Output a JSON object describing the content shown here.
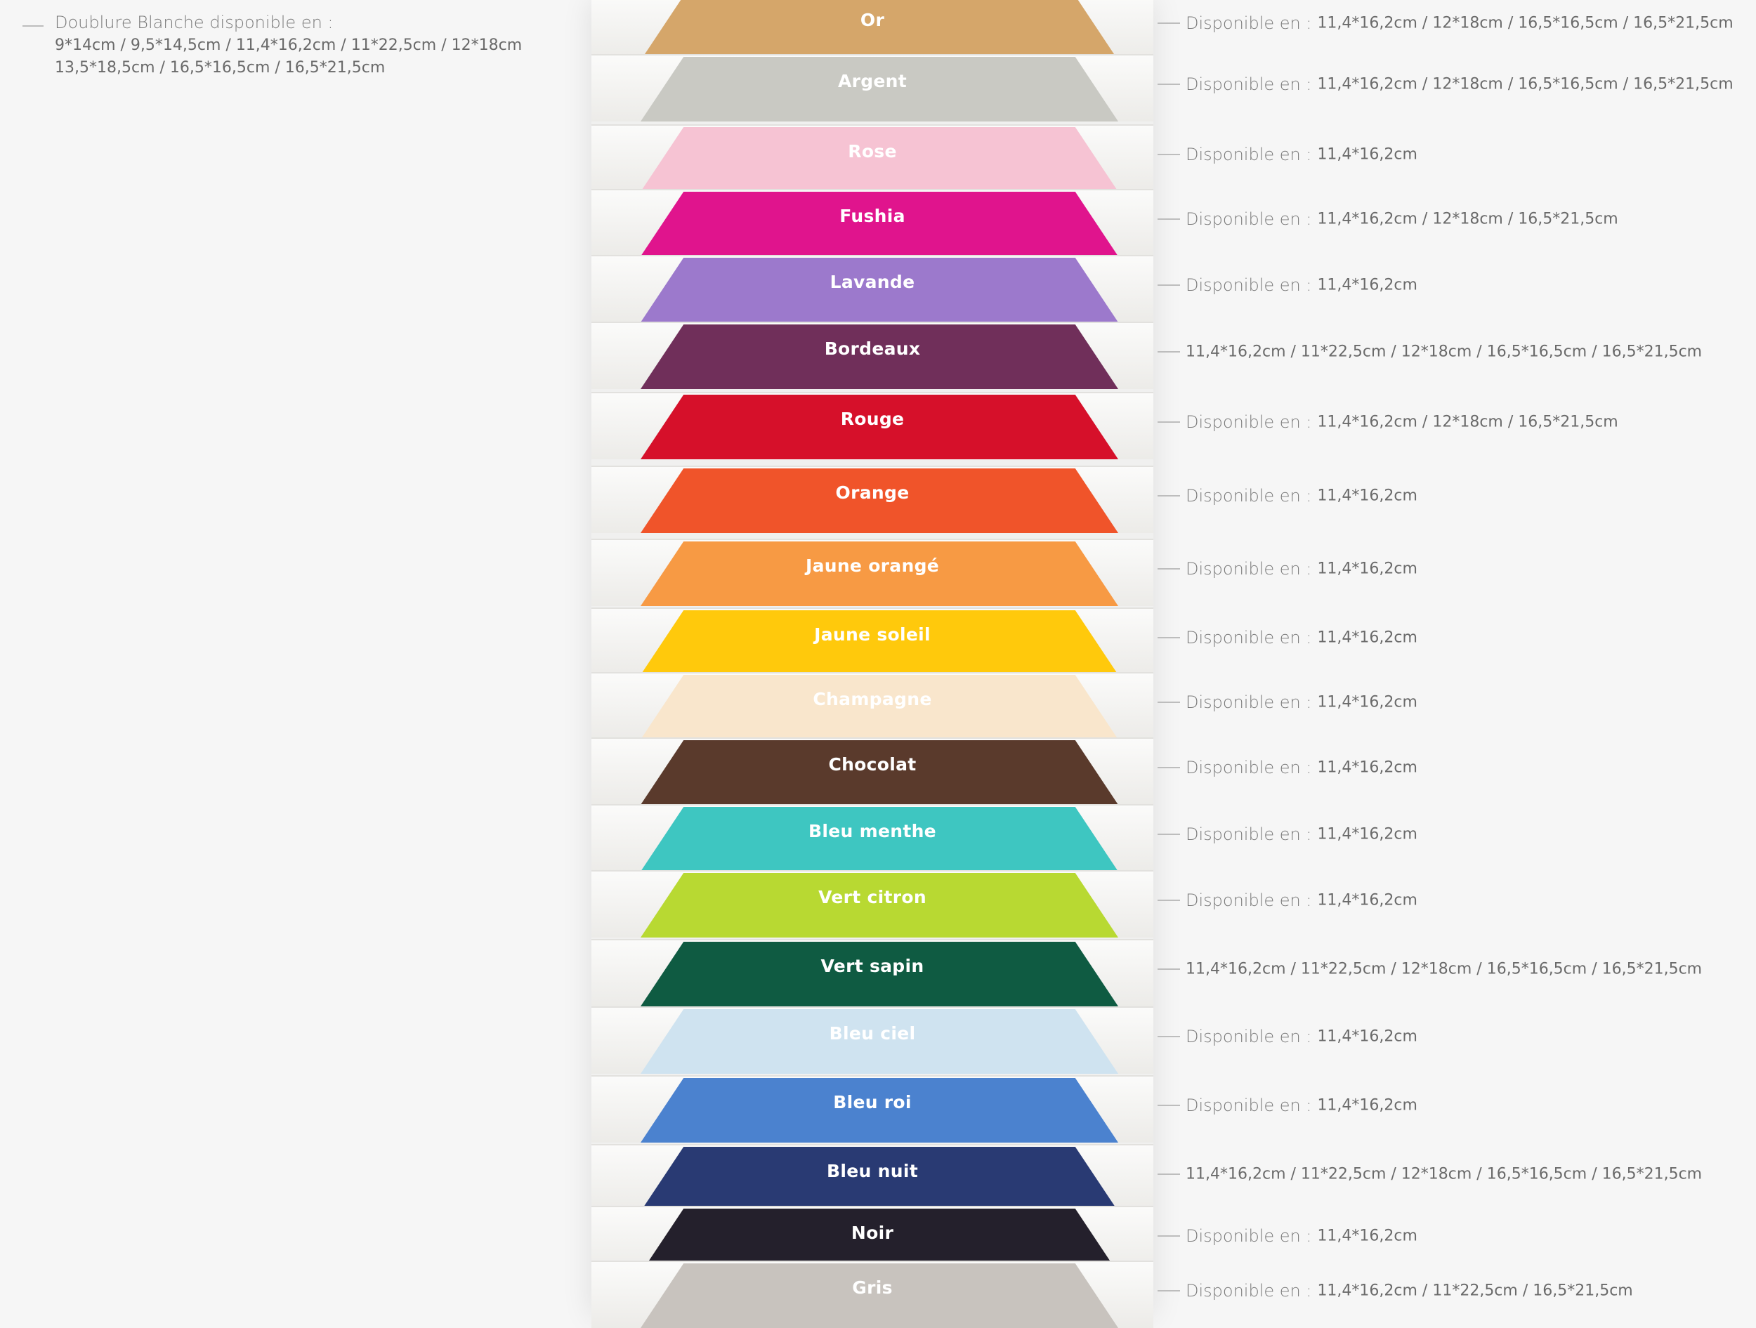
{
  "note": {
    "title": "Doublure Blanche disponible en :",
    "line1": "9*14cm / 9,5*14,5cm / 11,4*16,2cm / 11*22,5cm / 12*18cm",
    "line2": "13,5*18,5cm / 16,5*16,5cm / 16,5*21,5cm"
  },
  "colors": [
    {
      "name": "Or",
      "hex": "#d5a66a",
      "lbl": "Disponible en :",
      "sizes": "11,4*16,2cm / 12*18cm / 16,5*16,5cm / 16,5*21,5cm"
    },
    {
      "name": "Argent",
      "hex": "#c9c9c3",
      "lbl": "Disponible en :",
      "sizes": "11,4*16,2cm / 12*18cm / 16,5*16,5cm / 16,5*21,5cm"
    },
    {
      "name": "Rose",
      "hex": "#f6c3d3",
      "lbl": "Disponible en :",
      "sizes": "11,4*16,2cm"
    },
    {
      "name": "Fushia",
      "hex": "#e0148d",
      "lbl": "Disponible en :",
      "sizes": "11,4*16,2cm / 12*18cm / 16,5*21,5cm"
    },
    {
      "name": "Lavande",
      "hex": "#9c79cc",
      "lbl": "Disponible en :",
      "sizes": "11,4*16,2cm"
    },
    {
      "name": "Bordeaux",
      "hex": "#702f5a",
      "lbl": "",
      "sizes": "11,4*16,2cm / 11*22,5cm / 12*18cm / 16,5*16,5cm / 16,5*21,5cm"
    },
    {
      "name": "Rouge",
      "hex": "#d6102a",
      "lbl": "Disponible en :",
      "sizes": "11,4*16,2cm / 12*18cm / 16,5*21,5cm"
    },
    {
      "name": "Orange",
      "hex": "#f0542a",
      "lbl": "Disponible en :",
      "sizes": "11,4*16,2cm"
    },
    {
      "name": "Jaune orangé",
      "hex": "#f79a44",
      "lbl": "Disponible en :",
      "sizes": "11,4*16,2cm"
    },
    {
      "name": "Jaune soleil",
      "hex": "#ffc90c",
      "lbl": "Disponible en :",
      "sizes": "11,4*16,2cm"
    },
    {
      "name": "Champagne",
      "hex": "#f9e6cc",
      "lbl": "Disponible en :",
      "sizes": "11,4*16,2cm"
    },
    {
      "name": "Chocolat",
      "hex": "#5a3a2c",
      "lbl": "Disponible en :",
      "sizes": "11,4*16,2cm"
    },
    {
      "name": "Bleu menthe",
      "hex": "#3ec6c1",
      "lbl": "Disponible en :",
      "sizes": "11,4*16,2cm"
    },
    {
      "name": "Vert citron",
      "hex": "#b8d932",
      "lbl": "Disponible en :",
      "sizes": "11,4*16,2cm"
    },
    {
      "name": "Vert sapin",
      "hex": "#0f5b42",
      "lbl": "",
      "sizes": "11,4*16,2cm / 11*22,5cm / 12*18cm / 16,5*16,5cm / 16,5*21,5cm"
    },
    {
      "name": "Bleu ciel",
      "hex": "#cfe3f0",
      "lbl": "Disponible en :",
      "sizes": "11,4*16,2cm"
    },
    {
      "name": "Bleu roi",
      "hex": "#4b82cf",
      "lbl": "Disponible en :",
      "sizes": "11,4*16,2cm"
    },
    {
      "name": "Bleu nuit",
      "hex": "#293a73",
      "lbl": "",
      "sizes": "11,4*16,2cm / 11*22,5cm / 12*18cm / 16,5*16,5cm / 16,5*21,5cm"
    },
    {
      "name": "Noir",
      "hex": "#24202c",
      "lbl": "Disponible en :",
      "sizes": "11,4*16,2cm"
    },
    {
      "name": "Gris",
      "hex": "#c8c3be",
      "lbl": "Disponible en :",
      "sizes": "11,4*16,2cm / 11*22,5cm / 16,5*21,5cm"
    }
  ]
}
